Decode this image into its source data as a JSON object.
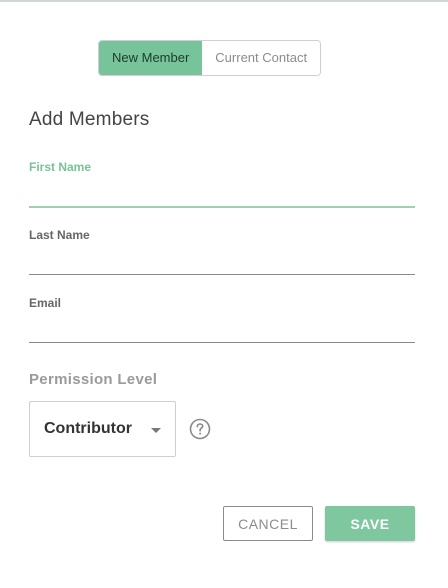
{
  "toggle": {
    "options": [
      "New Member",
      "Current Contact"
    ],
    "selected": "New Member"
  },
  "form": {
    "heading": "Add Members",
    "first_name": {
      "label": "First Name",
      "value": ""
    },
    "last_name": {
      "label": "Last Name",
      "value": ""
    },
    "email": {
      "label": "Email",
      "value": ""
    }
  },
  "permission": {
    "heading": "Permission Level",
    "selected": "Contributor",
    "help_icon": "question-circle-icon"
  },
  "actions": {
    "cancel_label": "CANCEL",
    "save_label": "SAVE"
  },
  "colors": {
    "accent": "#77c49a",
    "focus_label": "#79c297",
    "save_bg": "#7fc79f"
  }
}
